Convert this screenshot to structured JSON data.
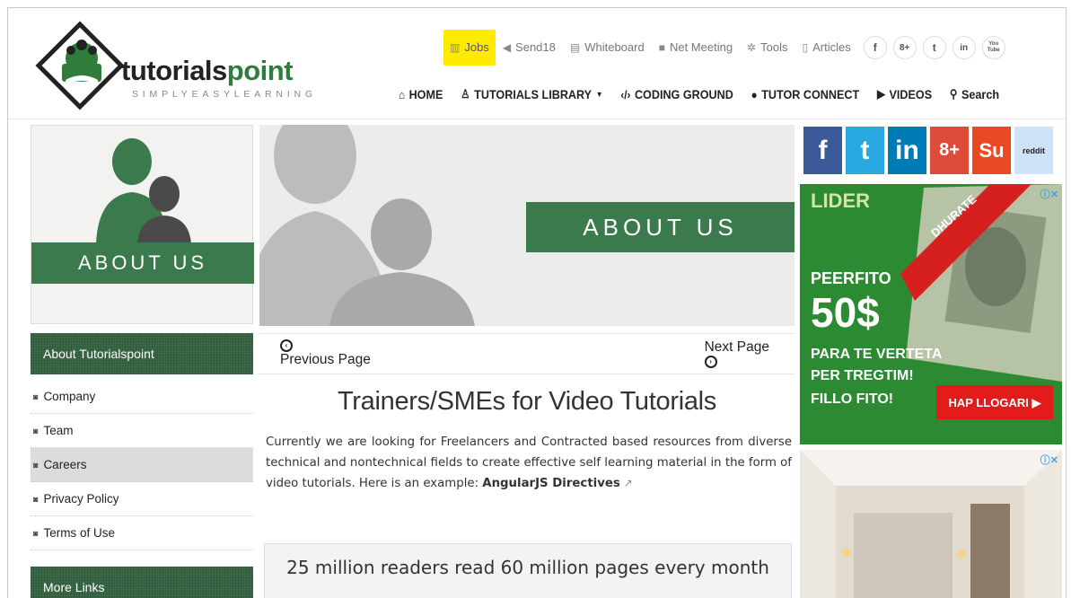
{
  "logo": {
    "brand_main": "tutorials",
    "brand_accent": "point",
    "tagline": "SIMPLYEASYLEARNING"
  },
  "topnav": [
    {
      "label": "Jobs",
      "icon": "briefcase-icon"
    },
    {
      "label": "Send18",
      "icon": "send-icon"
    },
    {
      "label": "Whiteboard",
      "icon": "whiteboard-icon"
    },
    {
      "label": "Net Meeting",
      "icon": "video-camera-icon"
    },
    {
      "label": "Tools",
      "icon": "gear-icon"
    },
    {
      "label": "Articles",
      "icon": "document-icon"
    }
  ],
  "social_top": [
    "f",
    "8+",
    "t",
    "in",
    "You Tube"
  ],
  "mainnav": [
    {
      "label": "HOME",
      "icon": "home-icon"
    },
    {
      "label": "TUTORIALS LIBRARY",
      "icon": "library-icon"
    },
    {
      "label": "CODING GROUND",
      "icon": "code-icon"
    },
    {
      "label": "TUTOR CONNECT",
      "icon": "user-icon"
    },
    {
      "label": "VIDEOS",
      "icon": "play-icon"
    },
    {
      "label": "Search",
      "icon": "search-icon"
    }
  ],
  "left_banner": {
    "caption": "ABOUT US"
  },
  "sidebar": {
    "heading": "About Tutorialspoint",
    "items": [
      "Company",
      "Team",
      "Careers",
      "Privacy Policy",
      "Terms of Use"
    ],
    "more_heading": "More Links"
  },
  "hero": {
    "caption": "ABOUT US"
  },
  "pager": {
    "prev": "Previous Page",
    "next": "Next Page"
  },
  "content": {
    "title": "Trainers/SMEs for Video Tutorials",
    "para": "Currently we are looking for Freelancers and Contracted based resources from diverse technical and nontechnical fields to create effective self learning material in the form of video tutorials. Here is an example:",
    "link": "AngularJS Directives",
    "stat": "25 million readers read 60 million pages every month"
  },
  "right_social": [
    "f",
    "t",
    "in",
    "8+",
    "Su",
    "reddit"
  ],
  "ad1": {
    "brand": "LIDER",
    "ribbon": "DHURATE",
    "line1": "PEERFITO",
    "amount": "50$",
    "line2": "PARA TE VERTETA",
    "line3": "PER TREGTIM!",
    "line4": "FILLO FITO!",
    "cta": "HAP LLOGARI ▶"
  }
}
